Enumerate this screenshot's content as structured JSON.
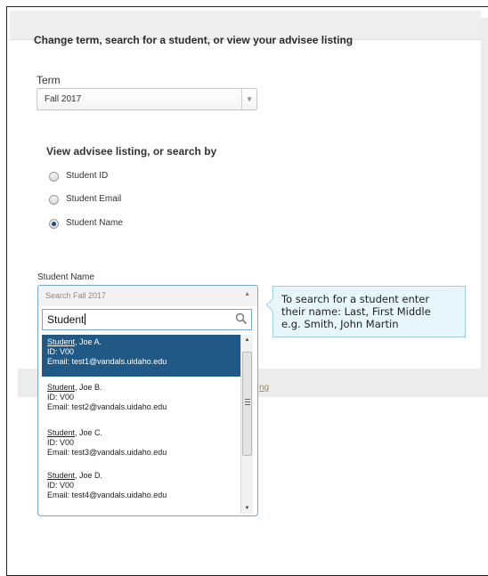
{
  "panel": {
    "title": "Change term, search for a student, or view your advisee listing"
  },
  "term": {
    "label": "Term",
    "value": "Fall 2017"
  },
  "view": {
    "title": "View advisee listing, or search by",
    "options": [
      {
        "label": "Student ID",
        "selected": false
      },
      {
        "label": "Student Email",
        "selected": false
      },
      {
        "label": "Student Name",
        "selected": true
      }
    ]
  },
  "student_name": {
    "label": "Student Name",
    "combo_placeholder": "Search Fall 2017",
    "search_value": "Student",
    "results": [
      {
        "name_match": "Student",
        "name_rest": ", Joe A.",
        "id": "ID: V00",
        "email": "Email: test1@vandals.uidaho.edu",
        "active": true
      },
      {
        "name_match": "Student",
        "name_rest": ", Joe B.",
        "id": "ID: V00",
        "email": "Email: test2@vandals.uidaho.edu",
        "active": false
      },
      {
        "name_match": "Student",
        "name_rest": ", Joe C.",
        "id": "ID: V00",
        "email": "Email: test3@vandals.uidaho.edu",
        "active": false
      },
      {
        "name_match": "Student",
        "name_rest": ", Joe D.",
        "id": "ID: V00",
        "email": "Email: test4@vandals.uidaho.edu",
        "active": false
      }
    ]
  },
  "tooltip": {
    "line1": "To search for a student enter",
    "line2": "their name: Last, First Middle",
    "line3": "e.g. Smith, John Martin"
  },
  "behind_link": "ng",
  "colors": {
    "selected_row": "#205986",
    "focus_border": "#7aa7cf",
    "tooltip_bg": "#e6f6fb"
  }
}
